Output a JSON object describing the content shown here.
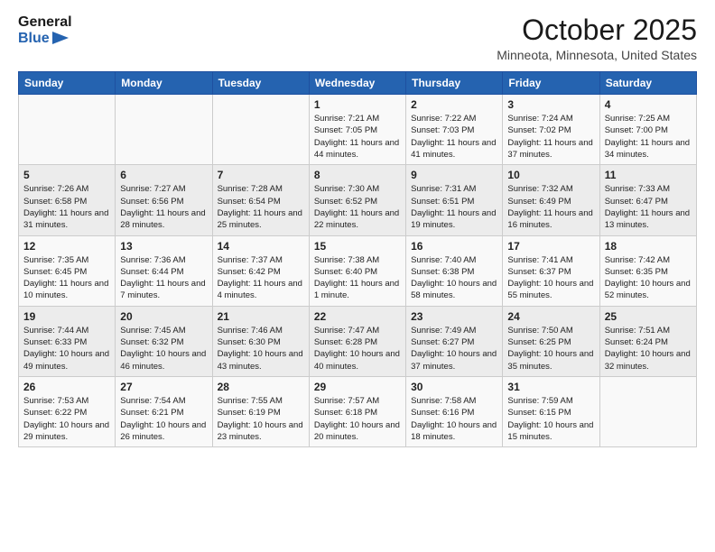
{
  "logo": {
    "general": "General",
    "blue": "Blue"
  },
  "title": "October 2025",
  "location": "Minneota, Minnesota, United States",
  "days_header": [
    "Sunday",
    "Monday",
    "Tuesday",
    "Wednesday",
    "Thursday",
    "Friday",
    "Saturday"
  ],
  "weeks": [
    [
      {
        "day": "",
        "info": ""
      },
      {
        "day": "",
        "info": ""
      },
      {
        "day": "",
        "info": ""
      },
      {
        "day": "1",
        "info": "Sunrise: 7:21 AM\nSunset: 7:05 PM\nDaylight: 11 hours and 44 minutes."
      },
      {
        "day": "2",
        "info": "Sunrise: 7:22 AM\nSunset: 7:03 PM\nDaylight: 11 hours and 41 minutes."
      },
      {
        "day": "3",
        "info": "Sunrise: 7:24 AM\nSunset: 7:02 PM\nDaylight: 11 hours and 37 minutes."
      },
      {
        "day": "4",
        "info": "Sunrise: 7:25 AM\nSunset: 7:00 PM\nDaylight: 11 hours and 34 minutes."
      }
    ],
    [
      {
        "day": "5",
        "info": "Sunrise: 7:26 AM\nSunset: 6:58 PM\nDaylight: 11 hours and 31 minutes."
      },
      {
        "day": "6",
        "info": "Sunrise: 7:27 AM\nSunset: 6:56 PM\nDaylight: 11 hours and 28 minutes."
      },
      {
        "day": "7",
        "info": "Sunrise: 7:28 AM\nSunset: 6:54 PM\nDaylight: 11 hours and 25 minutes."
      },
      {
        "day": "8",
        "info": "Sunrise: 7:30 AM\nSunset: 6:52 PM\nDaylight: 11 hours and 22 minutes."
      },
      {
        "day": "9",
        "info": "Sunrise: 7:31 AM\nSunset: 6:51 PM\nDaylight: 11 hours and 19 minutes."
      },
      {
        "day": "10",
        "info": "Sunrise: 7:32 AM\nSunset: 6:49 PM\nDaylight: 11 hours and 16 minutes."
      },
      {
        "day": "11",
        "info": "Sunrise: 7:33 AM\nSunset: 6:47 PM\nDaylight: 11 hours and 13 minutes."
      }
    ],
    [
      {
        "day": "12",
        "info": "Sunrise: 7:35 AM\nSunset: 6:45 PM\nDaylight: 11 hours and 10 minutes."
      },
      {
        "day": "13",
        "info": "Sunrise: 7:36 AM\nSunset: 6:44 PM\nDaylight: 11 hours and 7 minutes."
      },
      {
        "day": "14",
        "info": "Sunrise: 7:37 AM\nSunset: 6:42 PM\nDaylight: 11 hours and 4 minutes."
      },
      {
        "day": "15",
        "info": "Sunrise: 7:38 AM\nSunset: 6:40 PM\nDaylight: 11 hours and 1 minute."
      },
      {
        "day": "16",
        "info": "Sunrise: 7:40 AM\nSunset: 6:38 PM\nDaylight: 10 hours and 58 minutes."
      },
      {
        "day": "17",
        "info": "Sunrise: 7:41 AM\nSunset: 6:37 PM\nDaylight: 10 hours and 55 minutes."
      },
      {
        "day": "18",
        "info": "Sunrise: 7:42 AM\nSunset: 6:35 PM\nDaylight: 10 hours and 52 minutes."
      }
    ],
    [
      {
        "day": "19",
        "info": "Sunrise: 7:44 AM\nSunset: 6:33 PM\nDaylight: 10 hours and 49 minutes."
      },
      {
        "day": "20",
        "info": "Sunrise: 7:45 AM\nSunset: 6:32 PM\nDaylight: 10 hours and 46 minutes."
      },
      {
        "day": "21",
        "info": "Sunrise: 7:46 AM\nSunset: 6:30 PM\nDaylight: 10 hours and 43 minutes."
      },
      {
        "day": "22",
        "info": "Sunrise: 7:47 AM\nSunset: 6:28 PM\nDaylight: 10 hours and 40 minutes."
      },
      {
        "day": "23",
        "info": "Sunrise: 7:49 AM\nSunset: 6:27 PM\nDaylight: 10 hours and 37 minutes."
      },
      {
        "day": "24",
        "info": "Sunrise: 7:50 AM\nSunset: 6:25 PM\nDaylight: 10 hours and 35 minutes."
      },
      {
        "day": "25",
        "info": "Sunrise: 7:51 AM\nSunset: 6:24 PM\nDaylight: 10 hours and 32 minutes."
      }
    ],
    [
      {
        "day": "26",
        "info": "Sunrise: 7:53 AM\nSunset: 6:22 PM\nDaylight: 10 hours and 29 minutes."
      },
      {
        "day": "27",
        "info": "Sunrise: 7:54 AM\nSunset: 6:21 PM\nDaylight: 10 hours and 26 minutes."
      },
      {
        "day": "28",
        "info": "Sunrise: 7:55 AM\nSunset: 6:19 PM\nDaylight: 10 hours and 23 minutes."
      },
      {
        "day": "29",
        "info": "Sunrise: 7:57 AM\nSunset: 6:18 PM\nDaylight: 10 hours and 20 minutes."
      },
      {
        "day": "30",
        "info": "Sunrise: 7:58 AM\nSunset: 6:16 PM\nDaylight: 10 hours and 18 minutes."
      },
      {
        "day": "31",
        "info": "Sunrise: 7:59 AM\nSunset: 6:15 PM\nDaylight: 10 hours and 15 minutes."
      },
      {
        "day": "",
        "info": ""
      }
    ]
  ]
}
